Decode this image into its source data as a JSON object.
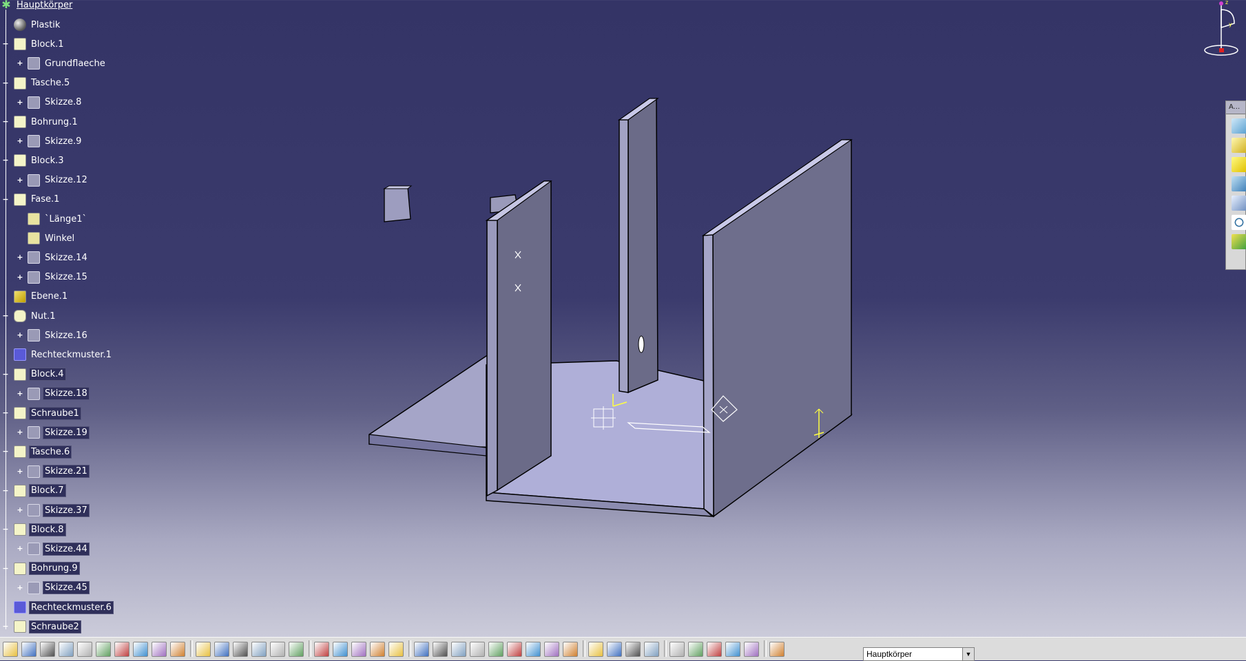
{
  "tree": {
    "root": "Hauptkörper",
    "nodes": [
      {
        "label": "Plastik",
        "icon": "material-icon",
        "kind": "mat",
        "expander": ""
      },
      {
        "label": "Block.1",
        "icon": "pad-icon",
        "kind": "feat",
        "expander": "−"
      },
      {
        "label": "Grundflaeche",
        "icon": "sketch-icon",
        "kind": "sketch",
        "expander": "+"
      },
      {
        "label": "Tasche.5",
        "icon": "pocket-icon",
        "kind": "feat",
        "expander": "−"
      },
      {
        "label": "Skizze.8",
        "icon": "sketch-icon",
        "kind": "sketch",
        "expander": "+"
      },
      {
        "label": "Bohrung.1",
        "icon": "hole-icon",
        "kind": "feat",
        "expander": "−"
      },
      {
        "label": "Skizze.9",
        "icon": "sketch-icon",
        "kind": "sketch",
        "expander": "+"
      },
      {
        "label": "Block.3",
        "icon": "pad-icon",
        "kind": "feat",
        "expander": "−"
      },
      {
        "label": "Skizze.12",
        "icon": "sketch-icon",
        "kind": "sketch",
        "expander": "+"
      },
      {
        "label": "Fase.1",
        "icon": "chamfer-icon",
        "kind": "feat",
        "expander": "−"
      },
      {
        "label": "`Länge1`",
        "icon": "parameter-icon",
        "kind": "param",
        "expander": ""
      },
      {
        "label": "Winkel",
        "icon": "parameter-icon",
        "kind": "param",
        "expander": ""
      },
      {
        "label": "Skizze.14",
        "icon": "sketch-icon",
        "kind": "sketch",
        "expander": "+"
      },
      {
        "label": "Skizze.15",
        "icon": "sketch-icon",
        "kind": "sketch",
        "expander": "+"
      },
      {
        "label": "Ebene.1",
        "icon": "plane-icon",
        "kind": "plane",
        "expander": ""
      },
      {
        "label": "Nut.1",
        "icon": "groove-icon",
        "kind": "groove",
        "expander": "−"
      },
      {
        "label": "Skizze.16",
        "icon": "sketch-icon",
        "kind": "sketch",
        "expander": "+"
      },
      {
        "label": "Rechteckmuster.1",
        "icon": "rect-pattern-icon",
        "kind": "pattern",
        "expander": ""
      },
      {
        "label": "Block.4",
        "icon": "pad-icon",
        "kind": "feat",
        "expander": "−"
      },
      {
        "label": "Skizze.18",
        "icon": "sketch-icon",
        "kind": "sketch",
        "expander": "+"
      },
      {
        "label": "Schraube1",
        "icon": "screw-icon",
        "kind": "feat",
        "expander": "−"
      },
      {
        "label": "Skizze.19",
        "icon": "sketch-icon",
        "kind": "sketch",
        "expander": "+"
      },
      {
        "label": "Tasche.6",
        "icon": "pocket-icon",
        "kind": "feat",
        "expander": "−"
      },
      {
        "label": "Skizze.21",
        "icon": "sketch-icon",
        "kind": "sketch",
        "expander": "+"
      },
      {
        "label": "Block.7",
        "icon": "pad-icon",
        "kind": "feat",
        "expander": "−"
      },
      {
        "label": "Skizze.37",
        "icon": "sketch-icon",
        "kind": "sketch",
        "expander": "+"
      },
      {
        "label": "Block.8",
        "icon": "pad-icon",
        "kind": "feat",
        "expander": "−"
      },
      {
        "label": "Skizze.44",
        "icon": "sketch-icon",
        "kind": "sketch",
        "expander": "+"
      },
      {
        "label": "Bohrung.9",
        "icon": "hole-icon",
        "kind": "feat",
        "expander": "−"
      },
      {
        "label": "Skizze.45",
        "icon": "sketch-icon",
        "kind": "sketch",
        "expander": "+"
      },
      {
        "label": "Rechteckmuster.6",
        "icon": "rect-pattern-icon",
        "kind": "pattern",
        "expander": ""
      },
      {
        "label": "Schraube2",
        "icon": "screw-icon",
        "kind": "feat",
        "expander": "−"
      }
    ]
  },
  "compass": {
    "z_label": "z",
    "y_label": "y"
  },
  "right_toolbar": {
    "title": "A..."
  },
  "bottom_toolbar": {
    "current_body": "Hauptkörper",
    "tools": [
      "new-icon",
      "open-icon",
      "save-icon",
      "print-icon",
      "cut-icon",
      "copy-icon",
      "paste-icon",
      "undo-icon",
      "redo-icon",
      "whats-this-icon",
      "formula-icon",
      "comment-icon",
      "sketch-tools-icon",
      "table-icon",
      "lock-icon",
      "publish-icon",
      "fly-icon",
      "fit-all-icon",
      "pan-icon",
      "rotate-icon",
      "zoom-in-icon",
      "zoom-out-icon",
      "normal-view-icon",
      "multi-view-icon",
      "iso-view-icon",
      "shading-icon",
      "hide-show-icon",
      "swap-space-icon",
      "scene-icon",
      "measure-icon",
      "apply-material-icon",
      "sensor-icon",
      "camera-icon",
      "refresh-icon",
      "manipulator-icon",
      "axis-system-icon",
      "grid-icon",
      "constraint-icon",
      "analysis-icon",
      "body-icon"
    ]
  },
  "colors": {
    "background_top": "#343466",
    "background_bottom": "#d4d4e0",
    "part_face": "#9b9bc3",
    "part_dark": "#6b6b86",
    "tree_text": "#ffffff",
    "highlight": "#2f2f5a",
    "sketch_yellow": "#ffff40"
  }
}
